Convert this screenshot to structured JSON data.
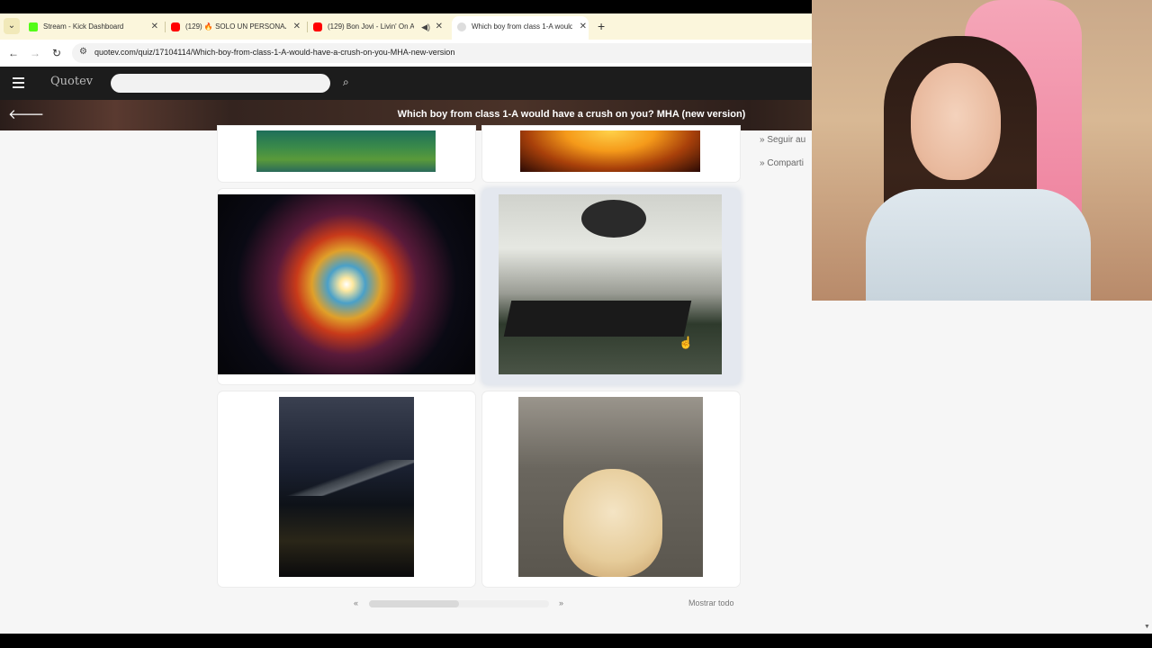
{
  "browser": {
    "tabs": [
      {
        "title": "Stream - Kick Dashboard",
        "favicon_color": "#53fc18",
        "active": false
      },
      {
        "title": "(129) 🔥 SOLO UN PERSONAJE",
        "favicon_color": "#ff0000",
        "active": false
      },
      {
        "title": "(129) Bon Jovi - Livin' On A",
        "favicon_color": "#ff0000",
        "active": false,
        "audio": true
      },
      {
        "title": "Which boy from class 1-A would",
        "favicon_color": "#cccccc",
        "active": true
      }
    ],
    "close_glyph": "✕",
    "new_tab_glyph": "+",
    "url": "quotev.com/quiz/17104114/Which-boy-from-class-1-A-would-have-a-crush-on-you-MHA-new-version"
  },
  "site": {
    "logo": "Quotev",
    "search_placeholder": "",
    "quiz_title": "Which boy from class 1-A would have a crush on you? MHA (new version)"
  },
  "answers": [
    {
      "name": "underwater reef"
    },
    {
      "name": "sun"
    },
    {
      "name": "nebula"
    },
    {
      "name": "operating room",
      "selected": true
    },
    {
      "name": "night city from plane"
    },
    {
      "name": "dogs"
    }
  ],
  "sidebar": {
    "follow": "Seguir au",
    "share": "Comparti"
  },
  "pager": {
    "prev": "«",
    "next": "»",
    "show_all": "Mostrar todo",
    "scroll_fraction": 0.5
  }
}
